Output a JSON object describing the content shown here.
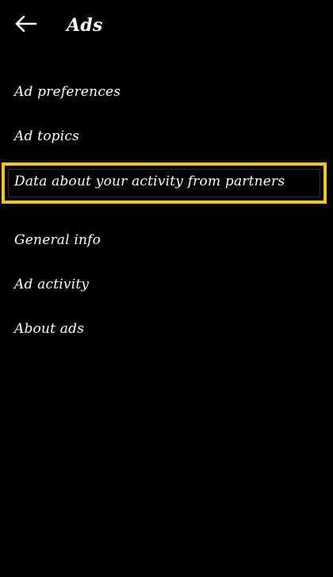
{
  "header": {
    "title": "Ads",
    "back_icon": "arrow-left-icon"
  },
  "menu": {
    "items": [
      {
        "label": "Ad preferences"
      },
      {
        "label": "Ad topics"
      },
      {
        "label": "Data about your activity from partners"
      },
      {
        "label": "General info"
      },
      {
        "label": "Ad activity"
      },
      {
        "label": "About ads"
      }
    ]
  },
  "colors": {
    "background": "#000000",
    "text": "#ffffff",
    "highlight": "#f5c518"
  }
}
